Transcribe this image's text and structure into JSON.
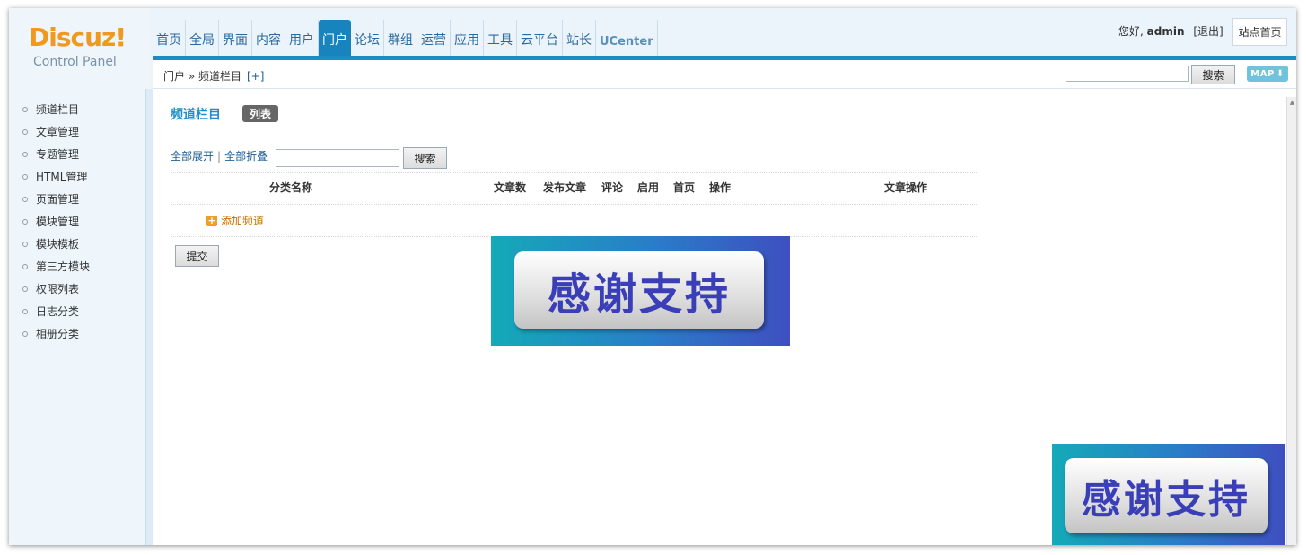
{
  "logo": {
    "main": "Discuz!",
    "sub": "Control Panel"
  },
  "nav": [
    {
      "label": "首页",
      "active": false
    },
    {
      "label": "全局",
      "active": false
    },
    {
      "label": "界面",
      "active": false
    },
    {
      "label": "内容",
      "active": false
    },
    {
      "label": "用户",
      "active": false
    },
    {
      "label": "门户",
      "active": true
    },
    {
      "label": "论坛",
      "active": false
    },
    {
      "label": "群组",
      "active": false
    },
    {
      "label": "运营",
      "active": false
    },
    {
      "label": "应用",
      "active": false
    },
    {
      "label": "工具",
      "active": false
    },
    {
      "label": "云平台",
      "active": false
    },
    {
      "label": "站长",
      "active": false
    },
    {
      "label": "UCenter",
      "active": false
    }
  ],
  "user": {
    "greeting": "您好,",
    "name": "admin",
    "logout": "[退出]",
    "site_home": "站点首页"
  },
  "breadcrumb": {
    "path": "门户 » 频道栏目",
    "add": "[+]"
  },
  "top_search": {
    "button": "搜索",
    "map": "MAP"
  },
  "sidebar": {
    "items": [
      "频道栏目",
      "文章管理",
      "专题管理",
      "HTML管理",
      "页面管理",
      "模块管理",
      "模块模板",
      "第三方模块",
      "权限列表",
      "日志分类",
      "相册分类"
    ]
  },
  "main": {
    "title": "频道栏目",
    "tab_list": "列表",
    "expand_all": "全部展开",
    "separator": "|",
    "collapse_all": "全部折叠",
    "search_button": "搜索",
    "columns": {
      "name": "分类名称",
      "articles": "文章数",
      "publish": "发布文章",
      "comment": "评论",
      "enabled": "启用",
      "home": "首页",
      "actions": "操作",
      "article_actions": "文章操作"
    },
    "add_channel": "添加频道",
    "submit": "提交"
  },
  "banner": {
    "text": "感谢支持"
  }
}
